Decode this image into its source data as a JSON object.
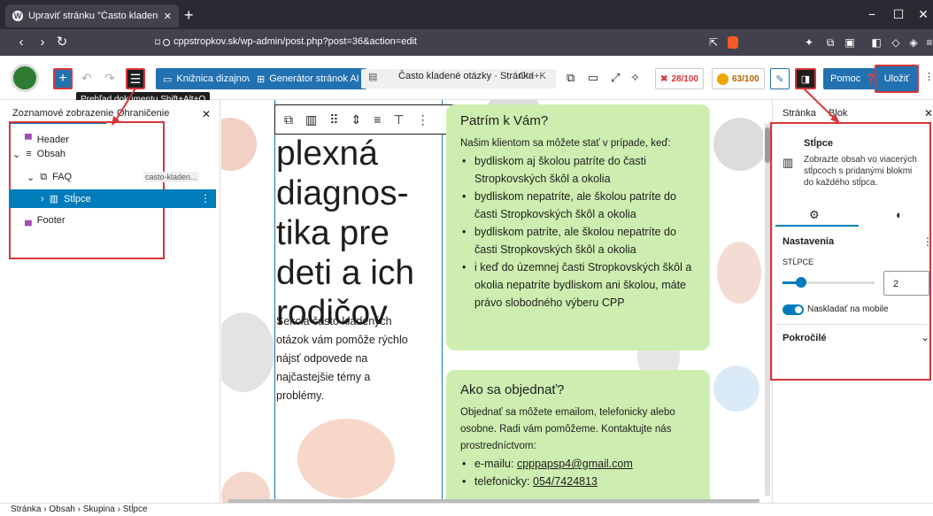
{
  "browser": {
    "tab_title": "Upraviť stránku \"Často kladené ...",
    "url": "cppstropkov.sk/wp-admin/post.php?post=36&action=edit"
  },
  "toolbar": {
    "library_label": "Knižnica dizajnov",
    "generator_label": "Generátor stránok AI",
    "doc_title": "Často kladené otázky · Stránka",
    "shortcut": "Ctrl+K",
    "score1": "28/100",
    "score2": "63/100",
    "help_label": "Pomoc",
    "save_label": "Uložiť",
    "tooltip": "Prehľad dokumentu  Shift+Alt+O"
  },
  "left_panel": {
    "tab_list": "Zoznamové zobrazenie",
    "tab_outline": "Ohraničenie",
    "items": [
      {
        "label": "Header"
      },
      {
        "label": "Obsah"
      },
      {
        "label": "FAQ",
        "anchor": "casto-kladen..."
      },
      {
        "label": "Stĺpce"
      },
      {
        "label": "Footer"
      }
    ]
  },
  "canvas": {
    "heading_top": "plexná",
    "heading_lines": [
      "diagnos-",
      "tika pre",
      "deti a ich",
      "rodičov"
    ],
    "intro": "Sekcia často kladených otázok vám pomôže rýchlo nájsť odpovede na najčastejšie témy a problémy.",
    "card1": {
      "title": "Patrím k Vám?",
      "intro": "Našim klientom sa môžete stať v prípade, keď:",
      "items": [
        "bydliskom aj školou patríte do časti Stropkovských škôl a okolia",
        "bydliskom nepatríte, ale školou patríte do časti Stropkovských škôl a okolia",
        "bydliskom patríte, ale školou nepatríte do časti Stropkovských škôl a okolia",
        "i keď do územnej časti Stropkovských škôl a okolia nepatríte bydliskom ani školou, máte právo slobodného výberu CPP"
      ]
    },
    "card2": {
      "title": "Ako sa objednať?",
      "intro": "Objednať sa môžete emailom, telefonicky alebo osobne. Radi vám pomôžeme. Kontaktujte nás prostredníctvom:",
      "email_label": "e-mailu:",
      "email": "cpppapsp4@gmail.com",
      "phone_label": "telefonicky:",
      "phone": "054/7424813"
    }
  },
  "right_panel": {
    "tab_page": "Stránka",
    "tab_block": "Blok",
    "block_name": "Stĺpce",
    "block_desc": "Zobrazte obsah vo viacerých stĺpcoch s pridanými blokmi do každého stĺpca.",
    "settings_label": "Nastavenia",
    "columns_label": "STĹPCE",
    "columns_value": "2",
    "columns_fraction": 0.2,
    "stack_label": "Naskladať na mobile",
    "advanced_label": "Pokročilé"
  },
  "breadcrumb": [
    "Stránka",
    "Obsah",
    "Skupina",
    "Stĺpce"
  ],
  "colors": {
    "accent": "#2271b1",
    "highlight": "#d63638",
    "card": "#cdeeb0"
  }
}
